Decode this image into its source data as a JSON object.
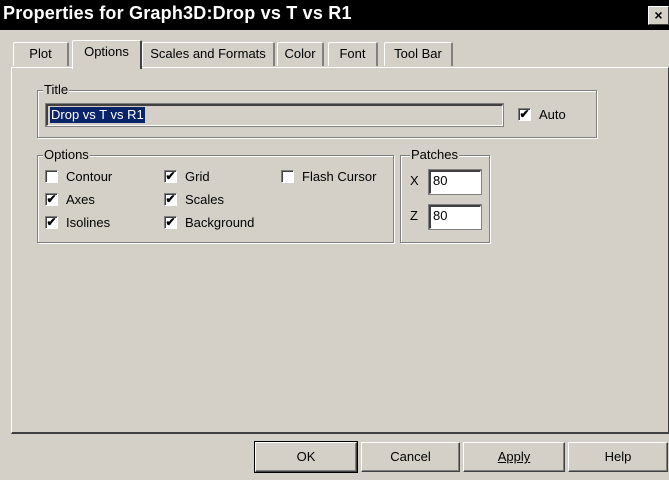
{
  "window": {
    "title": "Properties for Graph3D:Drop vs T vs R1",
    "close_glyph": "×"
  },
  "tabs": [
    {
      "label": "Plot",
      "active": false
    },
    {
      "label": "Options",
      "active": true
    },
    {
      "label": "Scales and Formats",
      "active": false
    },
    {
      "label": "Color",
      "active": false
    },
    {
      "label": "Font",
      "active": false
    },
    {
      "label": "Tool Bar",
      "active": false
    }
  ],
  "title_group": {
    "label": "Title",
    "value": "Drop vs T vs R1",
    "auto_label": "Auto",
    "auto_checked": true
  },
  "options_group": {
    "label": "Options",
    "items": [
      {
        "label": "Contour",
        "checked": false
      },
      {
        "label": "Axes",
        "checked": true
      },
      {
        "label": "Isolines",
        "checked": true
      },
      {
        "label": "Grid",
        "checked": true
      },
      {
        "label": "Scales",
        "checked": true
      },
      {
        "label": "Background",
        "checked": true
      },
      {
        "label": "Flash Cursor",
        "checked": false
      }
    ]
  },
  "patches_group": {
    "label": "Patches",
    "x_label": "X",
    "x_value": "80",
    "z_label": "Z",
    "z_value": "80"
  },
  "buttons": {
    "ok": "OK",
    "cancel": "Cancel",
    "apply": "Apply",
    "help": "Help"
  },
  "check_glyph": "✔"
}
